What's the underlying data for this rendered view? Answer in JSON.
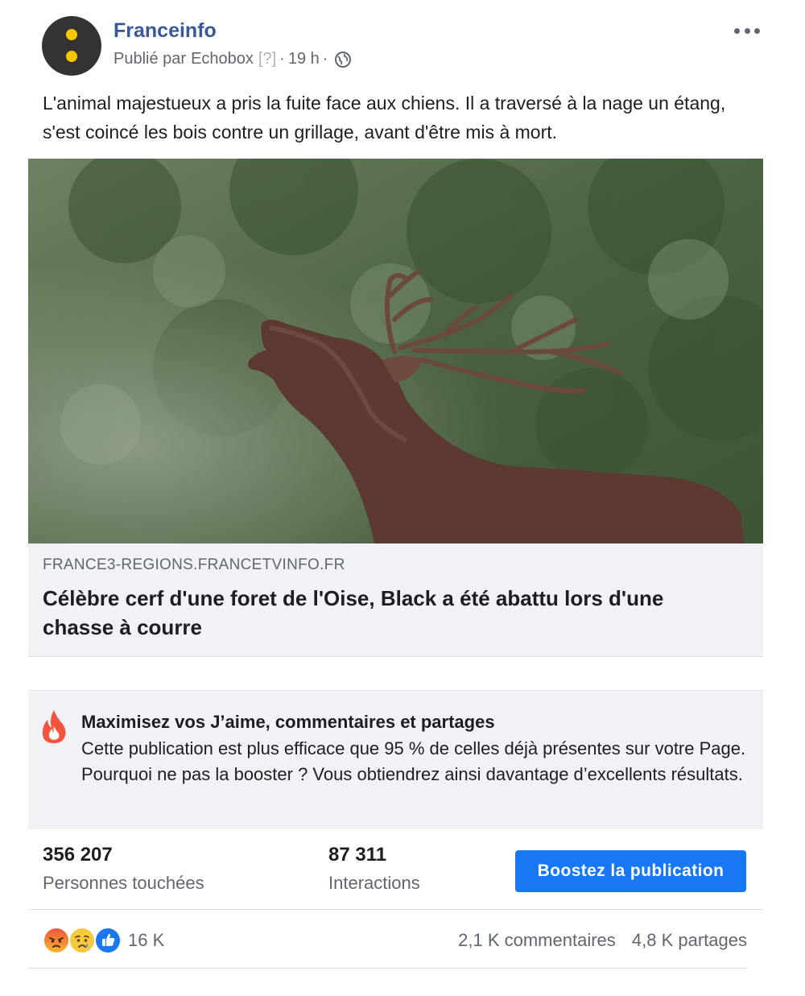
{
  "post": {
    "page_name": "Franceinfo",
    "published_by_prefix": "Publié par",
    "publisher": "Echobox",
    "publisher_tag": "[?]",
    "time": "19 h",
    "text": "L'animal majestueux a pris la fuite face aux chiens. Il a traversé à la nage un étang, s'est coincé les bois contre un grillage, avant d'être mis à mort.",
    "icons": {
      "privacy": "globe-icon",
      "menu": "more-options-icon"
    }
  },
  "link": {
    "image": "stag-photo",
    "domain": "FRANCE3-REGIONS.FRANCETVINFO.FR",
    "title": "Célèbre cerf d'une foret de l'Oise, Black a été abattu lors d'une chasse à courre"
  },
  "boost_tip": {
    "icon": "fire-icon",
    "title": "Maximisez vos J’aime, commentaires et partages",
    "body": "Cette publication est plus efficace que 95 % de celles déjà présentes sur votre Page. Pourquoi ne pas la booster ? Vous obtiendrez ainsi davantage d’excellents résultats."
  },
  "stats": {
    "reach_value": "356 207",
    "reach_label": "Personnes touchées",
    "interactions_value": "87 311",
    "interactions_label": "Interactions",
    "boost_button": "Boostez la publication"
  },
  "reactions": {
    "icons": [
      "angry-reaction-icon",
      "sad-reaction-icon",
      "like-reaction-icon"
    ],
    "count": "16 K",
    "comments": "2,1 K commentaires",
    "shares": "4,8 K partages"
  },
  "colors": {
    "brand_blue": "#1877f2",
    "page_name": "#385898",
    "secondary_text": "#606770",
    "card_bg": "#f0f2f5",
    "avatar_dots": "#f7c800"
  }
}
